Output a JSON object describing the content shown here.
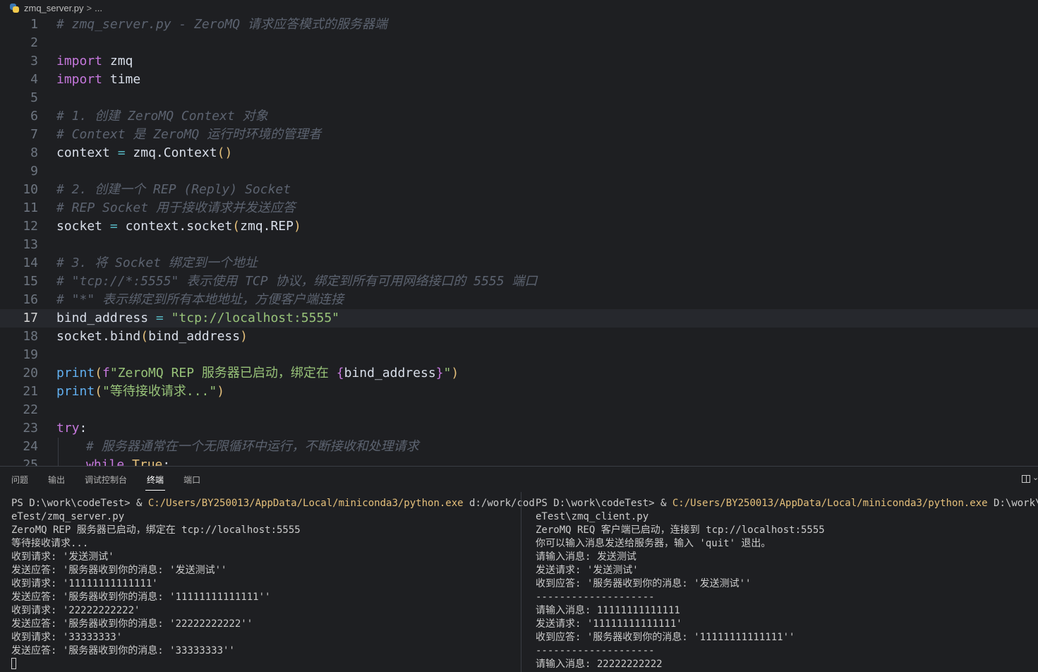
{
  "breadcrumb": {
    "file": "zmq_server.py",
    "chevron": ">",
    "ellipsis": "..."
  },
  "editor": {
    "lines": [
      {
        "n": "1"
      },
      {
        "n": "2"
      },
      {
        "n": "3"
      },
      {
        "n": "4"
      },
      {
        "n": "5"
      },
      {
        "n": "6"
      },
      {
        "n": "7"
      },
      {
        "n": "8"
      },
      {
        "n": "9"
      },
      {
        "n": "10"
      },
      {
        "n": "11"
      },
      {
        "n": "12"
      },
      {
        "n": "13"
      },
      {
        "n": "14"
      },
      {
        "n": "15"
      },
      {
        "n": "16"
      },
      {
        "n": "17"
      },
      {
        "n": "18"
      },
      {
        "n": "19"
      },
      {
        "n": "20"
      },
      {
        "n": "21"
      },
      {
        "n": "22"
      },
      {
        "n": "23"
      },
      {
        "n": "24"
      },
      {
        "n": "25"
      }
    ],
    "active_line": "17",
    "code": {
      "l1": "# zmq_server.py - ZeroMQ 请求应答模式的服务器端",
      "l3_kw": "import",
      "l3_id": "zmq",
      "l4_kw": "import",
      "l4_id": "time",
      "l6": "# 1. 创建 ZeroMQ Context 对象",
      "l7": "# Context 是 ZeroMQ 运行时环境的管理者",
      "l8_a": "context",
      "l8_op": "=",
      "l8_b": "zmq.Context",
      "l8_br": "()",
      "l10": "# 2. 创建一个 REP (Reply) Socket",
      "l11": "# REP Socket 用于接收请求并发送应答",
      "l12_a": "socket",
      "l12_op": "=",
      "l12_b": "context.socket",
      "l12_br1": "(",
      "l12_c": "zmq.REP",
      "l12_br2": ")",
      "l14": "# 3. 将 Socket 绑定到一个地址",
      "l15": "# \"tcp://*:5555\" 表示使用 TCP 协议，绑定到所有可用网络接口的 5555 端口",
      "l16": "# \"*\" 表示绑定到所有本地地址，方便客户端连接",
      "l17_a": "bind_address",
      "l17_op": "=",
      "l17_str": "\"tcp://localhost:5555\"",
      "l18_a": "socket.bind",
      "l18_br1": "(",
      "l18_b": "bind_address",
      "l18_br2": ")",
      "l20_fn": "print",
      "l20_br1": "(",
      "l20_f": "f",
      "l20_s1": "\"ZeroMQ REP 服务器已启动，绑定在 ",
      "l20_cb1": "{",
      "l20_var": "bind_address",
      "l20_cb2": "}",
      "l20_s2": "\"",
      "l20_br2": ")",
      "l21_fn": "print",
      "l21_br1": "(",
      "l21_str": "\"等待接收请求...\"",
      "l21_br2": ")",
      "l23_kw": "try",
      "l23_colon": ":",
      "l24": "# 服务器通常在一个无限循环中运行，不断接收和处理请求",
      "l25_kw": "while",
      "l25_val": "True",
      "l25_colon": ":"
    }
  },
  "panel": {
    "tabs": [
      "问题",
      "输出",
      "调试控制台",
      "终端",
      "端口"
    ],
    "active_tab": "终端",
    "left_terminal": {
      "prompt": "PS D:\\work\\codeTest> & ",
      "exe": "C:/Users/BY250013/AppData/Local/miniconda3/python.exe",
      "arg1": " d:/work/cod",
      "arg2": "eTest/zmq_server.py",
      "lines": [
        "ZeroMQ REP 服务器已启动，绑定在 tcp://localhost:5555",
        "等待接收请求...",
        "收到请求: '发送测试'",
        "发送应答: '服务器收到你的消息: '发送测试''",
        "收到请求: '11111111111111'",
        "发送应答: '服务器收到你的消息: '11111111111111''",
        "收到请求: '22222222222'",
        "发送应答: '服务器收到你的消息: '22222222222''",
        "收到请求: '33333333'",
        "发送应答: '服务器收到你的消息: '33333333''"
      ]
    },
    "right_terminal": {
      "prompt": "PS D:\\work\\codeTest> & ",
      "exe": "C:/Users/BY250013/AppData/Local/miniconda3/python.exe",
      "arg1": " D:\\work\\cod",
      "arg2": "eTest\\zmq_client.py",
      "lines": [
        "ZeroMQ REQ 客户端已启动，连接到 tcp://localhost:5555",
        "你可以输入消息发送给服务器，输入 'quit' 退出。",
        "请输入消息: 发送测试",
        "发送请求: '发送测试'",
        "收到应答: '服务器收到你的消息: '发送测试''",
        "--------------------",
        "请输入消息: 11111111111111",
        "发送请求: '11111111111111'",
        "收到应答: '服务器收到你的消息: '11111111111111''",
        "--------------------",
        "请输入消息: 22222222222"
      ]
    }
  }
}
